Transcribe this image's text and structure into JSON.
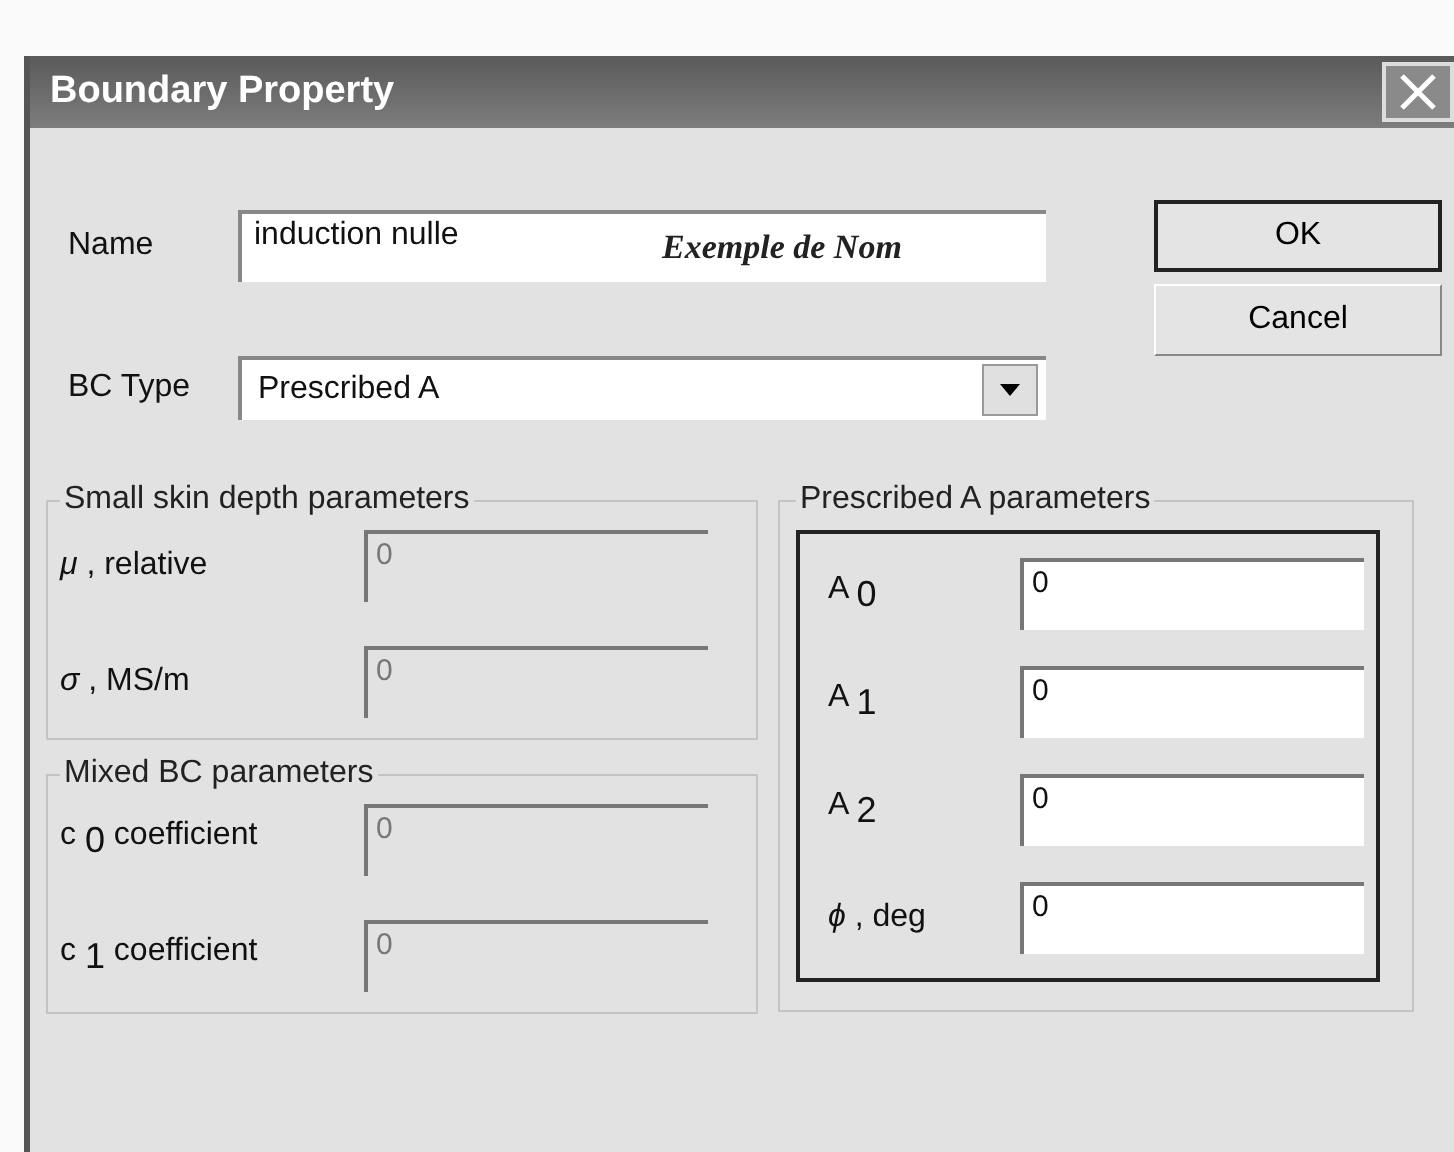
{
  "window": {
    "title": "Boundary Property"
  },
  "name": {
    "label": "Name",
    "value": "induction nulle",
    "annotation": "Exemple de Nom"
  },
  "bc_type": {
    "label": "BC Type",
    "value": "Prescribed A"
  },
  "buttons": [
    {
      "label": "OK",
      "default": true
    },
    {
      "label": "Cancel",
      "default": false
    }
  ],
  "groups": [
    {
      "title": "Small skin depth parameters",
      "framed": false,
      "fields": [
        {
          "label": "*μ* , relative",
          "value": "0",
          "disabled": true
        },
        {
          "label": "*σ* , MS/m",
          "value": "0",
          "disabled": true
        }
      ]
    },
    {
      "title": "Mixed BC parameters",
      "framed": false,
      "fields": [
        {
          "label": "c $_{0}$ coefficient",
          "value": "0",
          "disabled": true
        },
        {
          "label": "c $_{1}$ coefficient",
          "value": "0",
          "disabled": true
        }
      ]
    },
    {
      "title": "Prescribed A parameters",
      "framed": true,
      "fields": [
        {
          "label": "A $_{0}$",
          "value": "0",
          "disabled": false
        },
        {
          "label": "A $_{1}$",
          "value": "0",
          "disabled": false
        },
        {
          "label": "A $_{2}$",
          "value": "0",
          "disabled": false
        },
        {
          "label": "*ϕ* , deg",
          "value": "0",
          "disabled": false
        }
      ]
    }
  ]
}
